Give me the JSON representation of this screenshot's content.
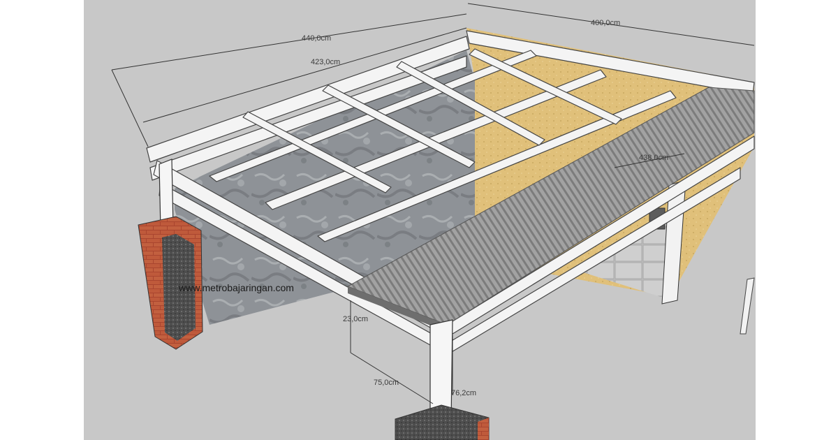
{
  "dimensions": {
    "outer_length": "440,0cm",
    "inner_length": "423,0cm",
    "width": "400,0cm",
    "roof_span": "438,0cm",
    "beam_depth": "23,0cm",
    "overhang": "75,0cm",
    "column_offset": "76,2cm"
  },
  "watermark": "www.metrobajaringan.com",
  "colors": {
    "background": "#c8c8c8",
    "frame": "#f4f4f4",
    "frame_edge": "#444444",
    "stone_wall": "#8e9297",
    "plaster_wall": "#e1c27c",
    "roof_sheet": "#9a9a9a",
    "brick": "#b0503a",
    "pillar_core": "#4a4a4a"
  }
}
